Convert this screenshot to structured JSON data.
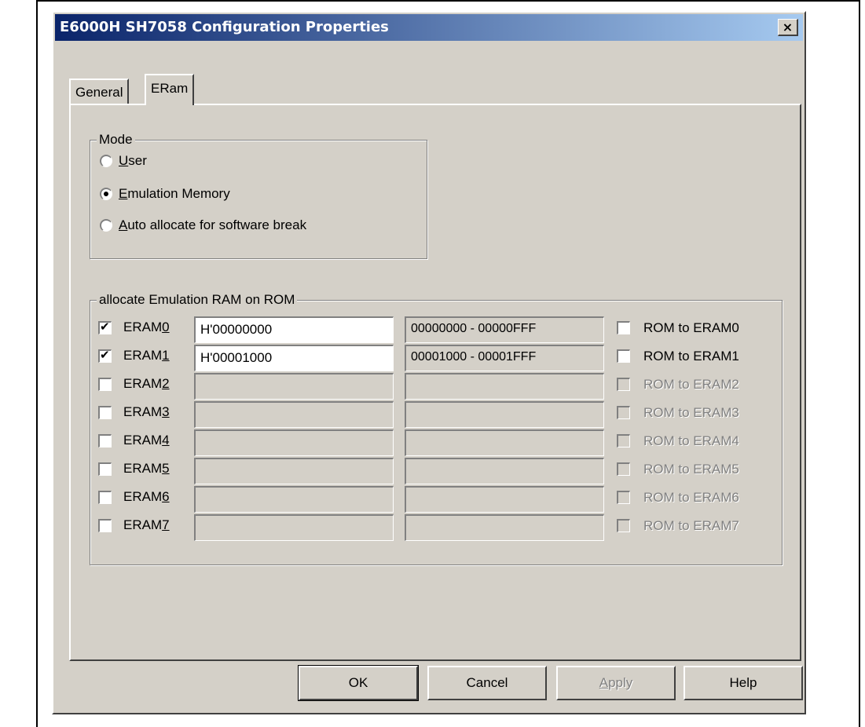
{
  "window": {
    "title": "E6000H SH7058 Configuration Properties",
    "close_glyph": "×"
  },
  "tabs": [
    {
      "label": "General",
      "selected": false
    },
    {
      "label": "ERam",
      "selected": true
    }
  ],
  "mode_group": {
    "legend": "Mode",
    "options": [
      {
        "pre": "",
        "ul": "U",
        "post": "ser",
        "selected": false
      },
      {
        "pre": "",
        "ul": "E",
        "post": "mulation Memory",
        "selected": true
      },
      {
        "pre": "",
        "ul": "A",
        "post": "uto allocate for software break",
        "selected": false
      }
    ]
  },
  "eram_group": {
    "legend": "allocate Emulation RAM on ROM",
    "rows": [
      {
        "label": "ERAM",
        "ul": "0",
        "checked": true,
        "address": "H'00000000",
        "range": "00000000 - 00000FFF",
        "rom_label": "ROM to ERAM0",
        "enabled": true
      },
      {
        "label": "ERAM",
        "ul": "1",
        "checked": true,
        "address": "H'00001000",
        "range": "00001000 - 00001FFF",
        "rom_label": "ROM to ERAM1",
        "enabled": true
      },
      {
        "label": "ERAM",
        "ul": "2",
        "checked": false,
        "address": "",
        "range": "",
        "rom_label": "ROM to ERAM2",
        "enabled": false
      },
      {
        "label": "ERAM",
        "ul": "3",
        "checked": false,
        "address": "",
        "range": "",
        "rom_label": "ROM to ERAM3",
        "enabled": false
      },
      {
        "label": "ERAM",
        "ul": "4",
        "checked": false,
        "address": "",
        "range": "",
        "rom_label": "ROM to ERAM4",
        "enabled": false
      },
      {
        "label": "ERAM",
        "ul": "5",
        "checked": false,
        "address": "",
        "range": "",
        "rom_label": "ROM to ERAM5",
        "enabled": false
      },
      {
        "label": "ERAM",
        "ul": "6",
        "checked": false,
        "address": "",
        "range": "",
        "rom_label": "ROM to ERAM6",
        "enabled": false
      },
      {
        "label": "ERAM",
        "ul": "7",
        "checked": false,
        "address": "",
        "range": "",
        "rom_label": "ROM to ERAM7",
        "enabled": false
      }
    ]
  },
  "buttons": {
    "ok": "OK",
    "cancel": "Cancel",
    "apply_ul": "A",
    "apply_rest": "pply",
    "help": "Help"
  },
  "colors": {
    "dialog_face": "#d4d0c8",
    "title_start": "#0a246a",
    "title_end": "#a6caf0",
    "disabled_text": "#808080"
  }
}
